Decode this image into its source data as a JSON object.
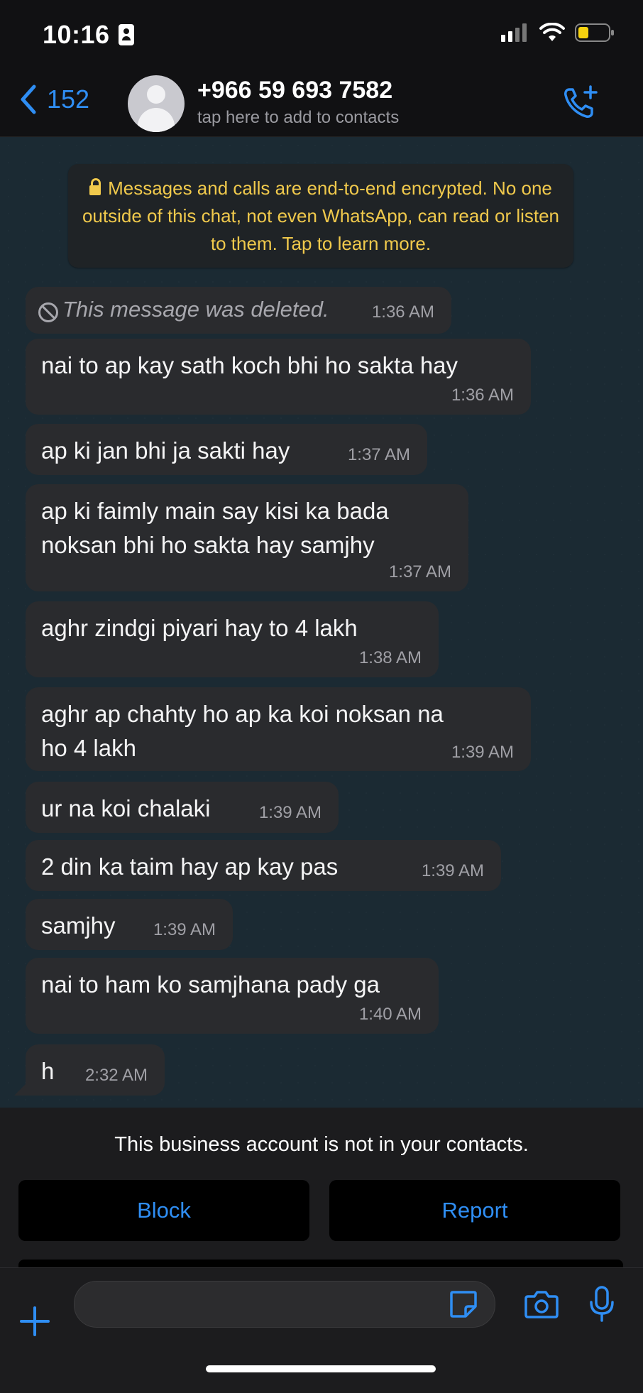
{
  "status_bar": {
    "time": "10:16"
  },
  "header": {
    "back_count": "152",
    "contact_name": "+966 59 693 7582",
    "contact_subtitle": "tap here to add to contacts"
  },
  "encryption_notice": "Messages and calls are end-to-end encrypted. No one outside of this chat, not even WhatsApp, can read or listen to them. Tap to learn more.",
  "messages": [
    {
      "text": "This message was deleted.",
      "time": "1:36 AM"
    },
    {
      "text": "nai to ap kay sath koch bhi ho sakta hay",
      "time": "1:36 AM"
    },
    {
      "text": "ap ki jan bhi ja sakti hay",
      "time": "1:37 AM"
    },
    {
      "text_line1": "ap ki faimly main say kisi ka bada",
      "text_line2": "noksan bhi ho sakta hay samjhy",
      "time": "1:37 AM"
    },
    {
      "text": "aghr zindgi piyari hay to 4 lakh",
      "time": "1:38 AM"
    },
    {
      "text_line1": "aghr ap chahty ho ap ka koi noksan na",
      "text_line2": "ho 4 lakh",
      "time": "1:39 AM"
    },
    {
      "text": "ur na koi chalaki",
      "time": "1:39 AM"
    },
    {
      "text": "2 din ka taim hay ap kay pas",
      "time": "1:39 AM"
    },
    {
      "text": "samjhy",
      "time": "1:39 AM"
    },
    {
      "text": "nai to ham ko samjhana pady ga",
      "time": "1:40 AM"
    },
    {
      "text": "h",
      "time": "2:32 AM"
    }
  ],
  "business_panel": {
    "notice": "This business account is not in your contacts.",
    "block_label": "Block",
    "report_label": "Report"
  },
  "colors": {
    "accent": "#2f8ef4",
    "bubble": "#2a2b2e",
    "chat_bg": "#1b2a33",
    "notice_text": "#f0c94c"
  }
}
